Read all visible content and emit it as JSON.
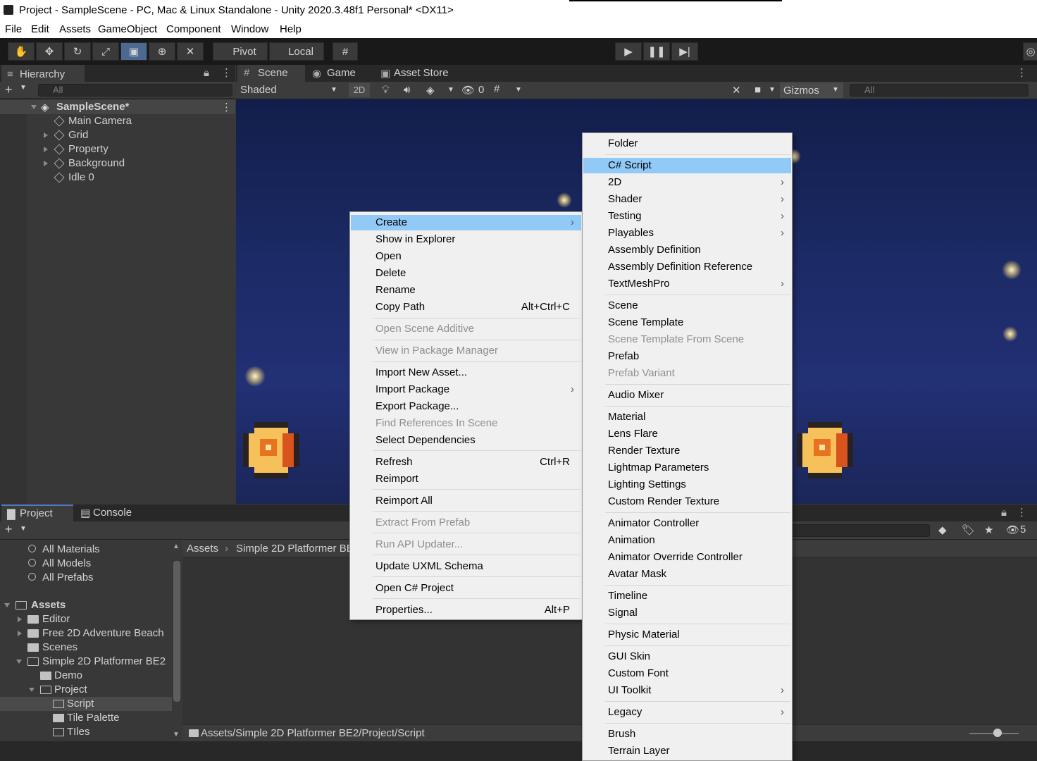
{
  "window": {
    "title": "Project - SampleScene - PC, Mac & Linux Standalone - Unity 2020.3.48f1 Personal* <DX11>"
  },
  "menubar": [
    "File",
    "Edit",
    "Assets",
    "GameObject",
    "Component",
    "Window",
    "Help"
  ],
  "toolbar": {
    "pivot_label": "Pivot",
    "local_label": "Local"
  },
  "hierarchy": {
    "tab_label": "Hierarchy",
    "search_placeholder": "All",
    "scene_name": "SampleScene*",
    "items": [
      "Main Camera",
      "Grid",
      "Property",
      "Background",
      "Idle 0"
    ]
  },
  "scene": {
    "tabs": [
      "Scene",
      "Game",
      "Asset Store"
    ],
    "shading_mode": "Shaded",
    "mode_2d": "2D",
    "hidden_count": "0",
    "gizmos_label": "Gizmos",
    "search_placeholder": "All"
  },
  "project": {
    "tabs": [
      "Project",
      "Console"
    ],
    "favorites": [
      "All Materials",
      "All Models",
      "All Prefabs"
    ],
    "tree": [
      "Assets",
      "Editor",
      "Free 2D Adventure Beach",
      "Scenes",
      "Simple 2D Platformer BE2",
      "Demo",
      "Project",
      "Script",
      "Tile Palette",
      "TIles"
    ],
    "breadcrumb": [
      "Assets",
      "Simple 2D Platformer BE2"
    ],
    "footer_path": "Assets/Simple 2D Platformer BE2/Project/Script",
    "hidden_count": "5"
  },
  "context_menu": {
    "items": [
      {
        "label": "Create",
        "submenu": true,
        "highlight": true
      },
      {
        "label": "Show in Explorer"
      },
      {
        "label": "Open"
      },
      {
        "label": "Delete"
      },
      {
        "label": "Rename"
      },
      {
        "label": "Copy Path",
        "shortcut": "Alt+Ctrl+C"
      },
      {
        "label": "Open Scene Additive",
        "disabled": true
      },
      {
        "label": "View in Package Manager",
        "disabled": true
      },
      {
        "label": "Import New Asset..."
      },
      {
        "label": "Import Package",
        "submenu": true
      },
      {
        "label": "Export Package..."
      },
      {
        "label": "Find References In Scene",
        "disabled": true
      },
      {
        "label": "Select Dependencies"
      },
      {
        "label": "Refresh",
        "shortcut": "Ctrl+R"
      },
      {
        "label": "Reimport"
      },
      {
        "label": "Reimport All"
      },
      {
        "label": "Extract From Prefab",
        "disabled": true
      },
      {
        "label": "Run API Updater...",
        "disabled": true
      },
      {
        "label": "Update UXML Schema"
      },
      {
        "label": "Open C# Project"
      },
      {
        "label": "Properties...",
        "shortcut": "Alt+P"
      }
    ]
  },
  "create_menu": {
    "items": [
      {
        "label": "Folder"
      },
      {
        "label": "C# Script",
        "highlight": true
      },
      {
        "label": "2D",
        "submenu": true
      },
      {
        "label": "Shader",
        "submenu": true
      },
      {
        "label": "Testing",
        "submenu": true
      },
      {
        "label": "Playables",
        "submenu": true
      },
      {
        "label": "Assembly Definition"
      },
      {
        "label": "Assembly Definition Reference"
      },
      {
        "label": "TextMeshPro",
        "submenu": true
      },
      {
        "label": "Scene"
      },
      {
        "label": "Scene Template"
      },
      {
        "label": "Scene Template From Scene",
        "disabled": true
      },
      {
        "label": "Prefab"
      },
      {
        "label": "Prefab Variant",
        "disabled": true
      },
      {
        "label": "Audio Mixer"
      },
      {
        "label": "Material"
      },
      {
        "label": "Lens Flare"
      },
      {
        "label": "Render Texture"
      },
      {
        "label": "Lightmap Parameters"
      },
      {
        "label": "Lighting Settings"
      },
      {
        "label": "Custom Render Texture"
      },
      {
        "label": "Animator Controller"
      },
      {
        "label": "Animation"
      },
      {
        "label": "Animator Override Controller"
      },
      {
        "label": "Avatar Mask"
      },
      {
        "label": "Timeline"
      },
      {
        "label": "Signal"
      },
      {
        "label": "Physic Material"
      },
      {
        "label": "GUI Skin"
      },
      {
        "label": "Custom Font"
      },
      {
        "label": "UI Toolkit",
        "submenu": true
      },
      {
        "label": "Legacy",
        "submenu": true
      },
      {
        "label": "Brush"
      },
      {
        "label": "Terrain Layer"
      }
    ]
  },
  "colors": {
    "menu_highlight": "#91c9f7",
    "scene_bg": "#1c2a66",
    "editor_bg": "#383838"
  }
}
